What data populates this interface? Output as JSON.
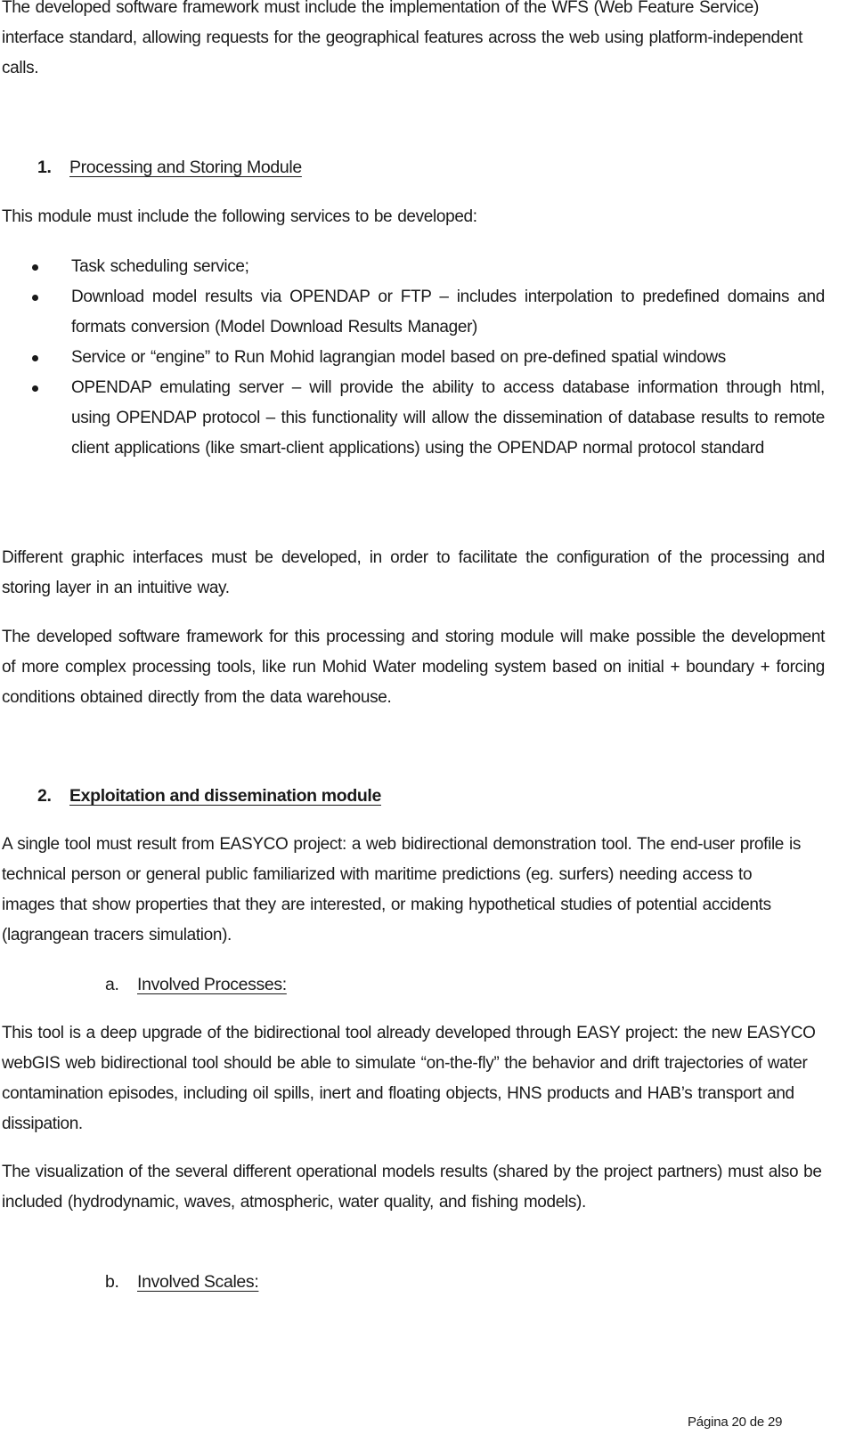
{
  "intro_paragraph": "The developed software framework must include the implementation of the WFS (Web Feature Service) interface standard, allowing requests for the geographical features across the web using platform-independent calls.",
  "section1": {
    "number": "1.",
    "title": "Processing and Storing Module",
    "lead": "This module must include the following services to be developed:",
    "bullets": [
      "Task scheduling service;",
      "Download model results via OPENDAP or FTP – includes interpolation to predefined domains and formats conversion (Model Download Results Manager)",
      "Service or “engine” to Run Mohid lagrangian model based on pre-defined spatial windows",
      "OPENDAP emulating server – will provide the ability to access database information through html, using OPENDAP protocol – this functionality will allow the dissemination of database results to remote client applications (like smart-client applications) using the OPENDAP normal protocol standard"
    ],
    "para_interfaces": "Different graphic interfaces must be developed, in order to facilitate the configuration of the processing and storing layer in an intuitive way.",
    "para_framework": "The developed software framework for this processing and storing module will make possible the development of more complex processing tools, like run Mohid Water modeling system based on initial + boundary + forcing conditions obtained directly from the data warehouse."
  },
  "section2": {
    "number": "2.",
    "title": "Exploitation and dissemination module",
    "para_tool": "A single tool must result from EASYCO project: a web bidirectional demonstration tool. The end-user profile is technical person or general public familiarized with maritime predictions (eg. surfers) needing access to images that show properties that they are interested, or making hypothetical studies of potential accidents (lagrangean tracers simulation).",
    "sub_a": {
      "number": "a.",
      "title": "Involved Processes:",
      "para_upgrade": "This tool is a deep upgrade of the bidirectional tool already developed through EASY project: the new EASYCO webGIS web bidirectional tool should be able to simulate “on-the-fly” the behavior and drift trajectories of water contamination episodes, including oil spills, inert and floating objects, HNS products and HAB’s transport and dissipation.",
      "para_visualization": "The visualization of the several different operational models results (shared by the project partners) must also be included (hydrodynamic, waves, atmospheric, water quality, and fishing models)."
    },
    "sub_b": {
      "number": "b.",
      "title": "Involved Scales:"
    }
  },
  "footer": {
    "page_label": "Página 20 de 29"
  }
}
